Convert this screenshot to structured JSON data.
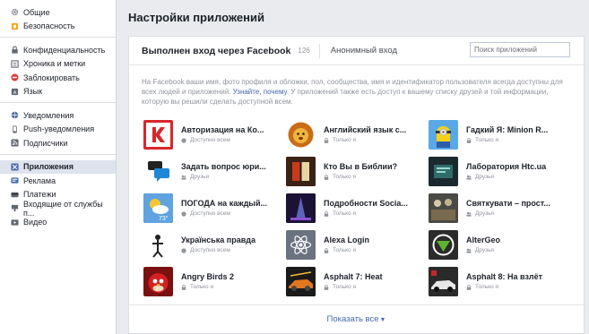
{
  "sidebar": {
    "groups": [
      [
        {
          "label": "Общие",
          "icon": "gear-icon"
        },
        {
          "label": "Безопасность",
          "icon": "shield-icon"
        }
      ],
      [
        {
          "label": "Конфиденциальность",
          "icon": "lock-icon"
        },
        {
          "label": "Хроника и метки",
          "icon": "timeline-icon"
        },
        {
          "label": "Заблокировать",
          "icon": "block-icon"
        },
        {
          "label": "Язык",
          "icon": "language-icon"
        }
      ],
      [
        {
          "label": "Уведомления",
          "icon": "globe-icon"
        },
        {
          "label": "Push-уведомления",
          "icon": "phone-icon"
        },
        {
          "label": "Подписчики",
          "icon": "rss-icon"
        }
      ],
      [
        {
          "label": "Приложения",
          "icon": "apps-icon",
          "active": true
        },
        {
          "label": "Реклама",
          "icon": "ads-icon"
        },
        {
          "label": "Платежи",
          "icon": "card-icon"
        },
        {
          "label": "Входящие от службы п...",
          "icon": "inbox-icon"
        },
        {
          "label": "Видео",
          "icon": "video-icon"
        }
      ]
    ]
  },
  "page_title": "Настройки приложений",
  "tabs": {
    "logged_in": "Выполнен вход через Facebook",
    "count": "126",
    "anonymous": "Анонимный вход"
  },
  "search": {
    "placeholder": "Поиск приложений"
  },
  "description": {
    "text": "На Facebook ваши имя, фото профиля и обложки, пол, сообщества, имя и идентификатор пользователя всегда доступны для всех людей и приложений.",
    "link": "Узнайте, почему",
    "text2": "У приложений также есть доступ к вашему списку друзей и той информации, которую вы решили сделать доступной всем."
  },
  "apps": [
    {
      "name": "Авторизация на Ко...",
      "visibility": "Доступно всем",
      "icon": "k-logo-icon"
    },
    {
      "name": "Английский язык с...",
      "visibility": "Только я",
      "icon": "lion-icon"
    },
    {
      "name": "Гадкий Я: Minion R...",
      "visibility": "Только я",
      "icon": "minion-icon"
    },
    {
      "name": "Задать вопрос юри...",
      "visibility": "Друзья",
      "icon": "chat-icon"
    },
    {
      "name": "Кто Вы в Библии?",
      "visibility": "Только я",
      "icon": "bible-icon"
    },
    {
      "name": "Лаборатория Htc.ua",
      "visibility": "Друзья",
      "icon": "htc-icon"
    },
    {
      "name": "ПОГОДА на каждый...",
      "visibility": "Доступно всем",
      "icon": "weather-icon"
    },
    {
      "name": "Подробности Socia...",
      "visibility": "Только я",
      "icon": "stage-icon"
    },
    {
      "name": "Святкувати – прост...",
      "visibility": "Друзья",
      "icon": "celebrate-icon"
    },
    {
      "name": "Українська правда",
      "visibility": "Доступно всем",
      "icon": "pravda-icon"
    },
    {
      "name": "Alexa Login",
      "visibility": "Только я",
      "icon": "atom-icon"
    },
    {
      "name": "AlterGeo",
      "visibility": "Друзья",
      "icon": "altergeo-icon"
    },
    {
      "name": "Angry Birds 2",
      "visibility": "Только я",
      "icon": "angry-bird-icon"
    },
    {
      "name": "Asphalt 7: Heat",
      "visibility": "Только я",
      "icon": "car-icon"
    },
    {
      "name": "Asphalt 8: На взлёт",
      "visibility": "Только я",
      "icon": "race-car-icon"
    }
  ],
  "footer": {
    "show_all": "Показать все"
  },
  "colors": {
    "link": "#4267b2",
    "active_bg": "#dfe3ee",
    "background": "#e9ebee"
  }
}
